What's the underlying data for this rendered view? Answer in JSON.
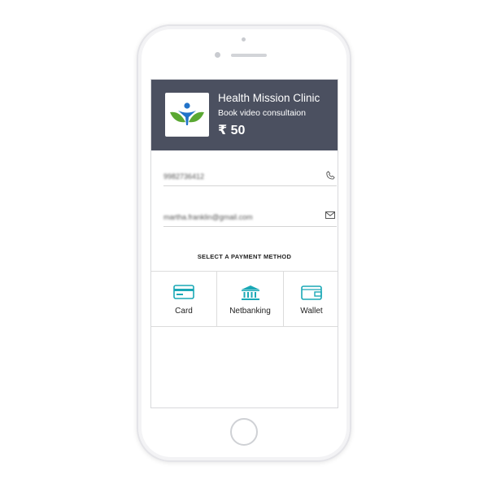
{
  "merchant": {
    "name": "Health Mission Clinic",
    "service": "Book video consultaion",
    "price": "₹ 50"
  },
  "contact": {
    "phone": "9982736412",
    "email": "martha.franklin@gmail.com"
  },
  "payment": {
    "title": "SELECT A PAYMENT METHOD",
    "methods": [
      {
        "label": "Card",
        "icon": "card-icon"
      },
      {
        "label": "Netbanking",
        "icon": "bank-icon"
      },
      {
        "label": "Wallet",
        "icon": "wallet-icon"
      }
    ]
  },
  "colors": {
    "header_bg": "#4b5060",
    "accent_teal": "#1aa8b6",
    "logo_green": "#5aa833",
    "logo_blue": "#2273c9"
  }
}
